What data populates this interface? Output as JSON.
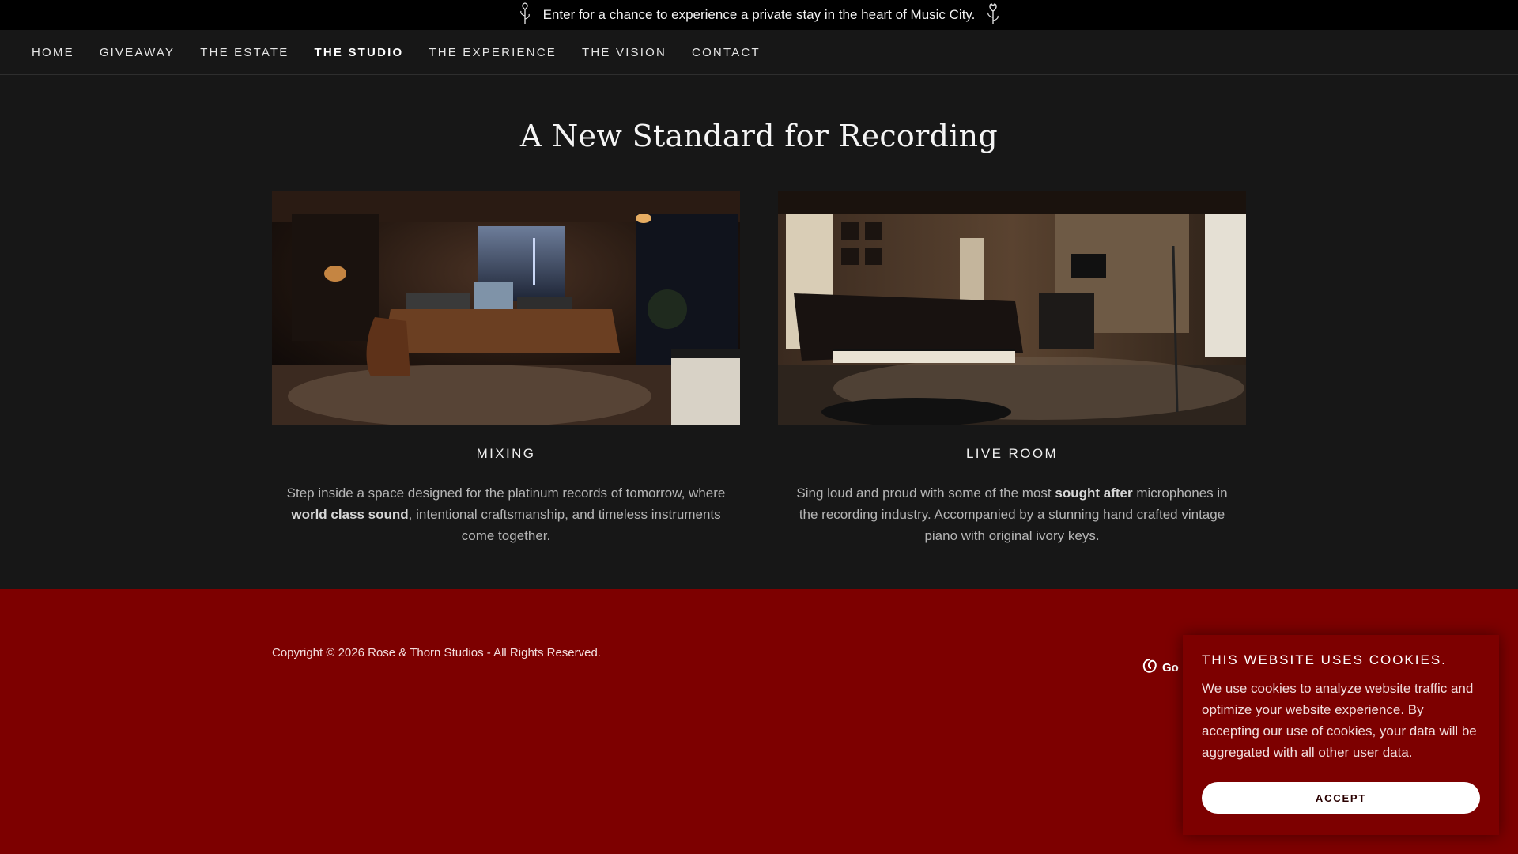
{
  "announcement": {
    "text": "Enter for a chance to experience a private stay in the heart of Music City."
  },
  "nav": {
    "items": [
      {
        "label": "HOME"
      },
      {
        "label": "GIVEAWAY"
      },
      {
        "label": "THE ESTATE"
      },
      {
        "label": "THE STUDIO"
      },
      {
        "label": "THE EXPERIENCE"
      },
      {
        "label": "THE VISION"
      },
      {
        "label": "CONTACT"
      }
    ],
    "active": "THE STUDIO"
  },
  "main": {
    "title": "A New Standard for Recording",
    "cards": [
      {
        "heading": "MIXING",
        "desc_before": "Step inside a space designed for the platinum records of tomorrow, where ",
        "desc_bold": "world class sound",
        "desc_after": ", intentional craftsmanship, and timeless instruments come together."
      },
      {
        "heading": "LIVE ROOM",
        "desc_before": "Sing loud and proud with some of the most ",
        "desc_bold": "sought after",
        "desc_after": " microphones in the recording industry. Accompanied by a stunning hand crafted vintage piano with original ivory keys."
      }
    ]
  },
  "footer": {
    "copyright": "Copyright © 2026 Rose & Thorn Studios - All Rights Reserved.",
    "brand_partial": "Go"
  },
  "cookie": {
    "title": "THIS WEBSITE USES COOKIES.",
    "text": "We use cookies to analyze website traffic and optimize your website experience. By accepting our use of cookies, your data will be aggregated with all other user data.",
    "accept_label": "ACCEPT"
  },
  "colors": {
    "page_bg": "#171717",
    "topbar_bg": "#000000",
    "footer_bg": "#7d0000",
    "text_light": "#e8e8e8"
  }
}
